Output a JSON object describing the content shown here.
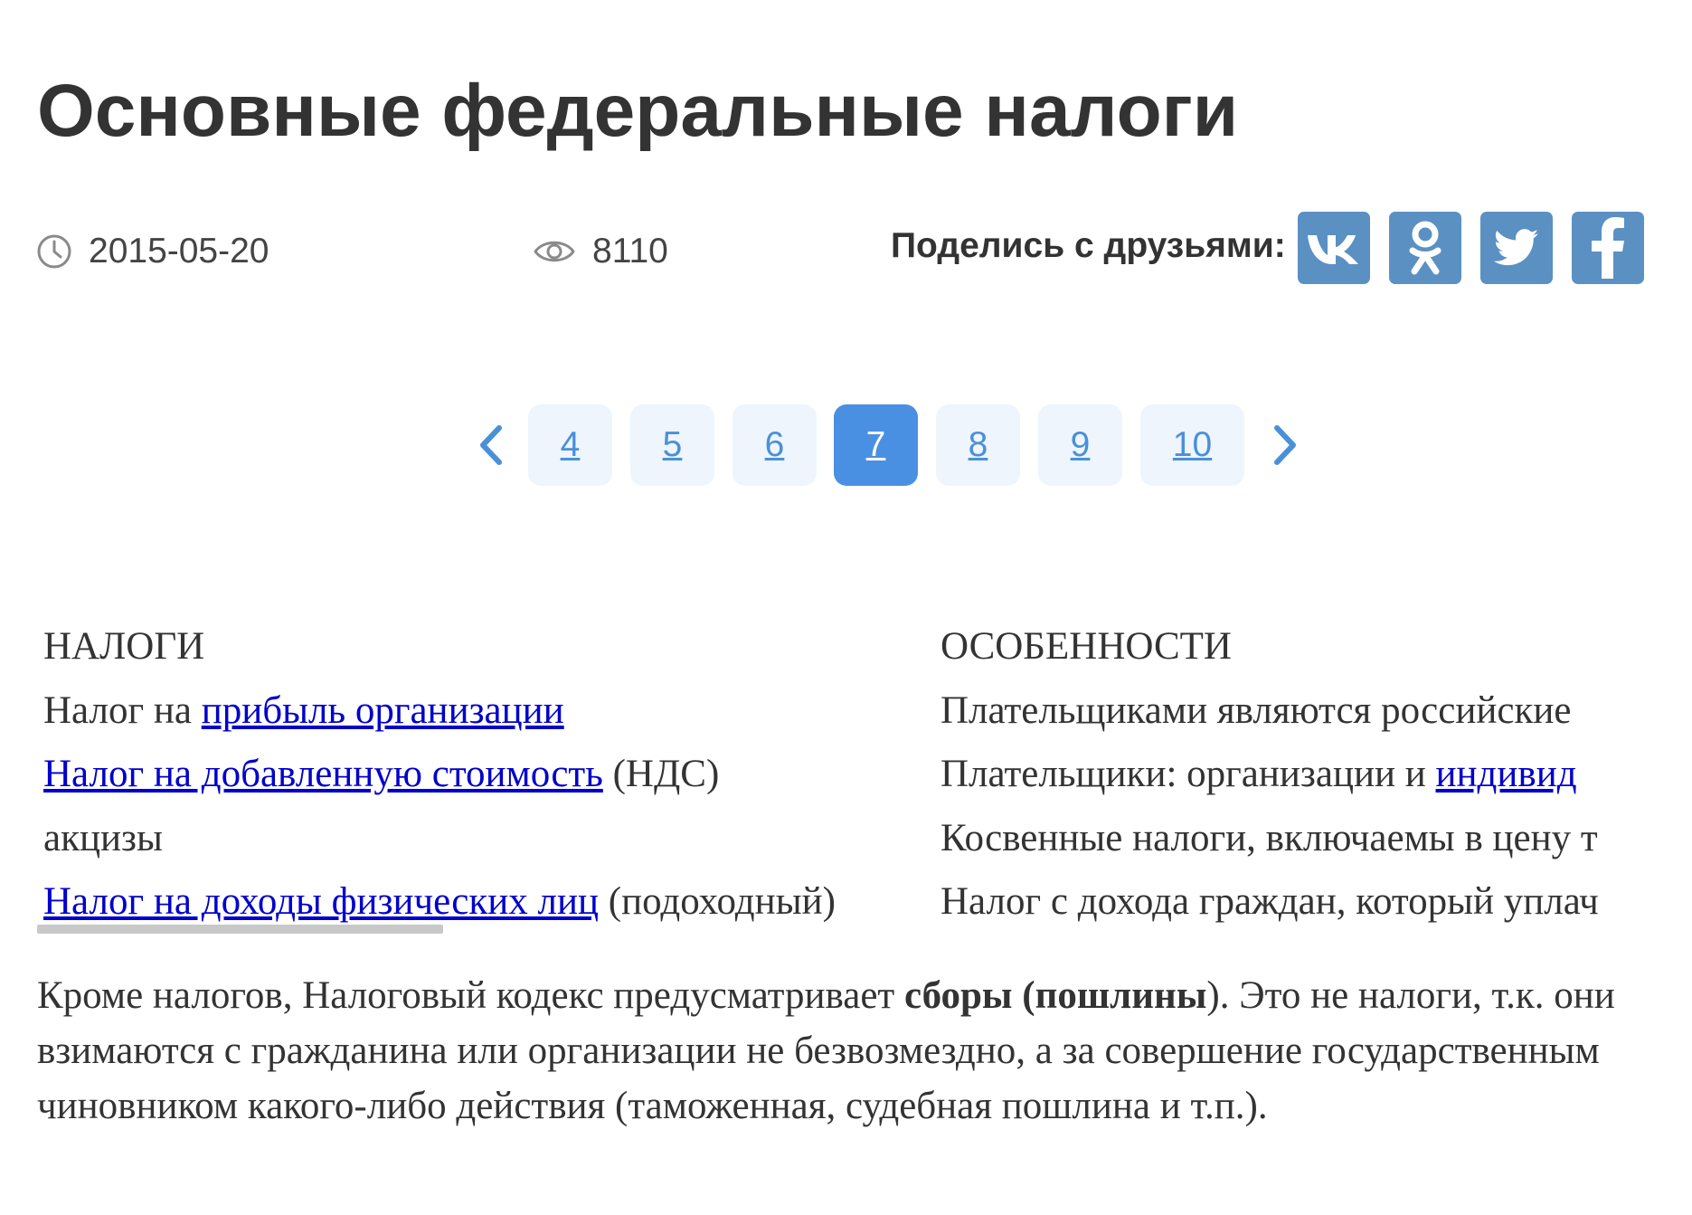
{
  "article": {
    "title": "Основные федеральные налоги",
    "date": "2015-05-20",
    "views": "8110",
    "date_icon": "clock-icon",
    "views_icon": "eye-icon"
  },
  "share": {
    "label": "Поделись с друзьями:",
    "networks": [
      {
        "name": "vk",
        "icon": "vk-icon"
      },
      {
        "name": "odnoklassniki",
        "icon": "odnoklassniki-icon"
      },
      {
        "name": "twitter",
        "icon": "twitter-icon"
      },
      {
        "name": "facebook",
        "icon": "facebook-icon"
      }
    ],
    "color": "#5b90c2"
  },
  "pagination": {
    "prev_icon": "chevron-left-icon",
    "next_icon": "chevron-right-icon",
    "pages": [
      "4",
      "5",
      "6",
      "7",
      "8",
      "9",
      "10"
    ],
    "current": "7",
    "accent": "#4a90e2"
  },
  "table": {
    "headers": [
      "НАЛОГИ",
      "ОСОБЕННОСТИ"
    ],
    "rows": [
      {
        "tax_prefix": "Налог на ",
        "tax_link": "прибыль организации",
        "tax_suffix": "",
        "feature_text": "Плательщиками являются российские",
        "feature_link": ""
      },
      {
        "tax_prefix": "",
        "tax_link": "Налог на добавленную стоимость",
        "tax_suffix": " (НДС)",
        "feature_text": "Плательщики: организации и ",
        "feature_link": "индивид"
      },
      {
        "tax_prefix": "акцизы",
        "tax_link": "",
        "tax_suffix": "",
        "feature_text": "Косвенные налоги, включаемы в цену т",
        "feature_link": ""
      },
      {
        "tax_prefix": "",
        "tax_link": "Налог на доходы физических лиц",
        "tax_suffix": " (подоходный)",
        "feature_text": "Налог с дохода граждан, который уплач",
        "feature_link": ""
      }
    ]
  },
  "note": {
    "before": "Кроме налогов, Налоговый кодекс предусматривает ",
    "bold": "сборы (пошлины",
    "after": "). Это не налоги, т.к. они взимаются с гражданина или организации не безвозмездно, а за совершение государственным чиновником какого-либо действия (таможенная, судебная пошлина и т.п.)."
  }
}
